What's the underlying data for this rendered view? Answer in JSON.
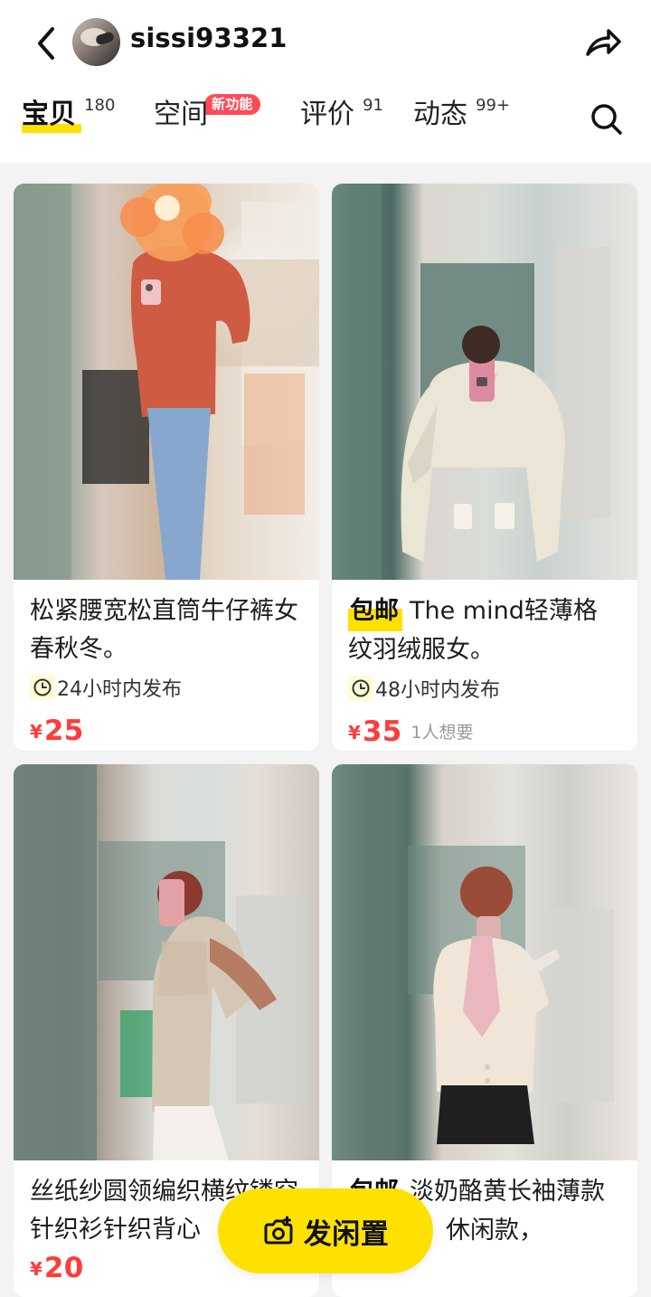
{
  "header": {
    "username": "sissi93321",
    "tabs": [
      {
        "label": "宝贝",
        "count": "180"
      },
      {
        "label": "空间",
        "badge": "新功能"
      },
      {
        "label": "评价",
        "count": "91"
      },
      {
        "label": "动态",
        "count": "99+"
      }
    ]
  },
  "products": [
    {
      "title": "松紧腰宽松直筒牛仔裤女春秋冬。",
      "time_label": "24小时内发布",
      "currency": "¥",
      "price": "25"
    },
    {
      "shipping_badge": "包邮",
      "title": "The mind轻薄格纹羽绒服女。",
      "time_label": "48小时内发布",
      "currency": "¥",
      "price": "35",
      "want_count": "1人想要"
    },
    {
      "title": "丝纸纱圆领编织横纹镂空针织衫针织背心",
      "currency": "¥",
      "price": "20"
    },
    {
      "shipping_badge": "包邮",
      "title": "淡奶酪黄长袖薄款外套女，休闲款，"
    }
  ],
  "post_button": {
    "label": "发闲置"
  },
  "colors": {
    "accent_yellow": "#ffe100",
    "price_red": "#ff3b3b",
    "badge_red": "#ff4a58",
    "page_bg": "#f3f3f3"
  },
  "icons": {
    "back": "chevron-left-icon",
    "share": "share-arrow-icon",
    "search": "search-icon",
    "clock": "clock-icon",
    "camera": "camera-plus-icon"
  }
}
